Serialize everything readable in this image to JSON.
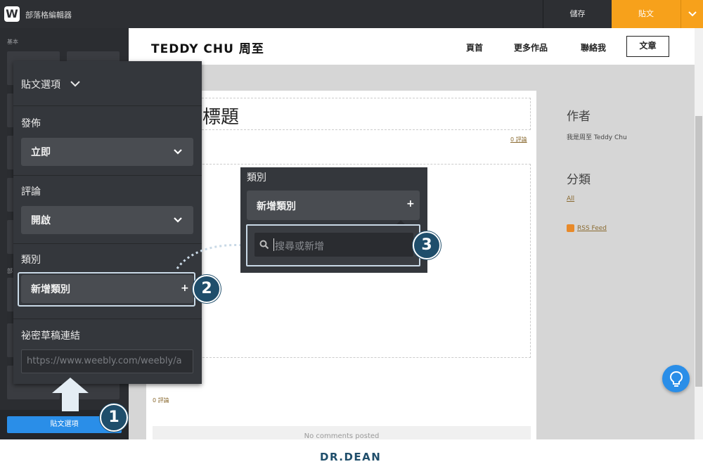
{
  "app": {
    "logo_glyph": "W",
    "title": "部落格編輯器",
    "save_label": "儲存",
    "publish_label": "貼文"
  },
  "sidebar": {
    "basic_label": "基本",
    "section2_label": "部",
    "post_options_label": "貼文選項"
  },
  "site": {
    "title": "TEDDY CHU 周至",
    "nav": [
      "頁首",
      "更多作品",
      "聯絡我",
      "文章"
    ]
  },
  "post": {
    "title": "標題",
    "comments_top": "0 評論",
    "comments_bottom": "0 評論",
    "no_comments": "No comments posted"
  },
  "right_sidebar": {
    "author_heading": "作者",
    "author_name": "我是周至 Teddy Chu",
    "categories_heading": "分類",
    "categories_all": "All",
    "rss_label": "RSS Feed"
  },
  "panel": {
    "title": "貼文選項",
    "publish_label": "發佈",
    "publish_value": "立即",
    "comments_label": "評論",
    "comments_value": "開啟",
    "category_label": "類別",
    "category_value": "新增類別",
    "secret_link_label": "祕密草稿連結",
    "secret_link_value": "https://www.weebly.com/weebly/a"
  },
  "zoom": {
    "category_label": "類別",
    "add_category": "新增類別",
    "search_placeholder": "搜尋或新增"
  },
  "badges": [
    "1",
    "2",
    "3"
  ],
  "footer": {
    "logo": "DR.DEAN"
  },
  "colors": {
    "accent_orange": "#f7a11b",
    "accent_blue": "#2a8ee8",
    "badge_navy": "#1f4e6b",
    "panel_bg": "#34373c"
  }
}
